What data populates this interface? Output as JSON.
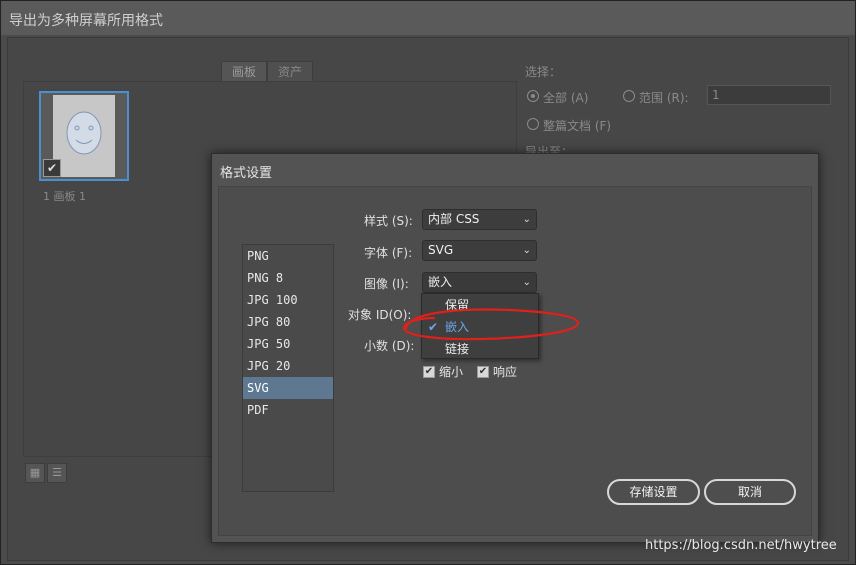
{
  "window": {
    "title": "导出为多种屏幕所用格式"
  },
  "tabs": [
    {
      "label": "画板"
    },
    {
      "label": "资产"
    }
  ],
  "artboard": {
    "label": "1  画板 1"
  },
  "right_panel": {
    "select_label": "选择：",
    "all_label": "全部 (A)",
    "range_label": "范围 (R):",
    "range_value": "1",
    "whole_doc_label": "整篇文档 (F)",
    "export_to_label": "导出至："
  },
  "dialog": {
    "title": "格式设置",
    "formats": [
      "PNG",
      "PNG 8",
      "JPG 100",
      "JPG 80",
      "JPG 50",
      "JPG 20",
      "SVG",
      "PDF"
    ],
    "selected_format": "SVG",
    "style_label": "样式 (S):",
    "style_value": "内部 CSS",
    "font_label": "字体 (F):",
    "font_value": "SVG",
    "image_label": "图像 (I):",
    "image_value": "嵌入",
    "object_id_label": "对象 ID(O):",
    "decimal_label": "小数 (D):",
    "image_options": [
      "保留",
      "嵌入",
      "链接"
    ],
    "image_selected": "嵌入",
    "minify_label": "缩小",
    "responsive_label": "响应",
    "minify_checked": true,
    "responsive_checked": true,
    "save_button": "存储设置",
    "cancel_button": "取消"
  },
  "watermark": "https://blog.csdn.net/hwytree",
  "colors": {
    "selection": "#5f7891",
    "accent_blue": "#4a8fd0",
    "annotation_red": "#e0201a"
  }
}
